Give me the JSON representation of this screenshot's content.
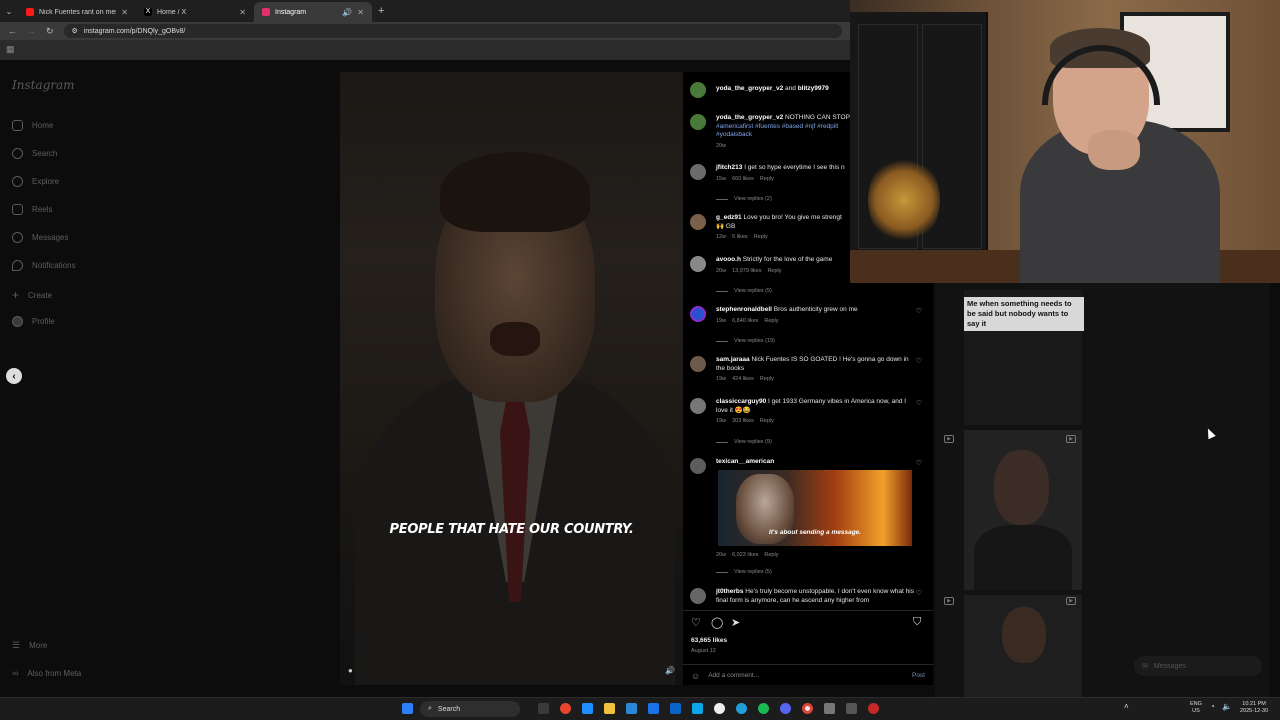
{
  "browser": {
    "tabs": [
      {
        "title": "Nick Fuentes rant on merit and",
        "favicon_color": "#ff1a1a"
      },
      {
        "title": "Home / X",
        "favicon_color": "#ffffff"
      },
      {
        "title": "Instagram",
        "favicon_color": "#e1306c"
      }
    ],
    "url": "instagram.com/p/DNQly_gOBv8/"
  },
  "instagram": {
    "logo": "Instagram",
    "nav": [
      {
        "label": "Home",
        "icon": "home-icon"
      },
      {
        "label": "Search",
        "icon": "search-icon"
      },
      {
        "label": "Explore",
        "icon": "compass-icon"
      },
      {
        "label": "Reels",
        "icon": "reels-icon"
      },
      {
        "label": "Messages",
        "icon": "messenger-icon"
      },
      {
        "label": "Notifications",
        "icon": "heart-icon"
      },
      {
        "label": "Create",
        "icon": "plus-icon"
      },
      {
        "label": "Profile",
        "icon": "profile-icon"
      }
    ],
    "more_label": "More",
    "also_meta_label": "Also from Meta",
    "video_caption": "PEOPLE THAT HATE OUR COUNTRY.",
    "post_header": {
      "user": "yoda_the_groyper_v2",
      "and": "and",
      "collab": "blitzy9979"
    },
    "post_caption": {
      "user": "yoda_the_groyper_v2",
      "text": "NOTHING CAN STOP",
      "hashtags": "#americafirst #fuentes #based #njf #redpill",
      "hashtags2": "#yodaisback",
      "age": "20w"
    },
    "comments": [
      {
        "user": "jfitch213",
        "text": "I get so hype everytime I see this n",
        "age": "15w",
        "likes": "660 likes",
        "reply": "Reply",
        "view_replies": "View replies (2)"
      },
      {
        "user": "g_edz91",
        "text": "Love you bro! You give me strengt",
        "text2": "🙌 GB",
        "age": "12w",
        "likes": "5 likes",
        "reply": "Reply"
      },
      {
        "user": "avooo.h",
        "text": "Strictly for the love of the game",
        "age": "20w",
        "likes": "13,979 likes",
        "reply": "Reply",
        "view_replies": "View replies (9)"
      },
      {
        "user": "stephenronaldbell",
        "text": "Bros authenticity grew on me",
        "age": "19w",
        "likes": "6,840 likes",
        "reply": "Reply",
        "view_replies": "View replies (19)"
      },
      {
        "user": "sam.jaraaa",
        "text": "Nick Fuentes IS SO GOATED ! He's gonna go down in the books",
        "age": "19w",
        "likes": "424 likes",
        "reply": "Reply"
      },
      {
        "user": "classiccarguy90",
        "text": "I get 1933 Germany vibes in America now, and I love it 😍😂",
        "age": "19w",
        "likes": "303 likes",
        "reply": "Reply",
        "view_replies": "View replies (9)"
      },
      {
        "user": "texican__american",
        "text": "",
        "gif_caption": "It's about sending a message.",
        "age": "20w",
        "likes": "6,023 likes",
        "reply": "Reply",
        "view_replies": "View replies (5)"
      },
      {
        "user": "jt0therbs",
        "text": "He's truly become unstoppable. I don't even know what his final form is anymore, can he ascend any higher from"
      }
    ],
    "like_count": "63,665 likes",
    "post_date": "August 12",
    "add_comment_placeholder": "Add a comment...",
    "post_button": "Post",
    "reel_caption": "Me when something needs to be said but nobody wants to say it",
    "messages_label": "Messages"
  },
  "taskbar": {
    "search_label": "Search",
    "lang": "ENG",
    "region": "US",
    "time": "10:21 PM",
    "date": "2025-12-30"
  }
}
